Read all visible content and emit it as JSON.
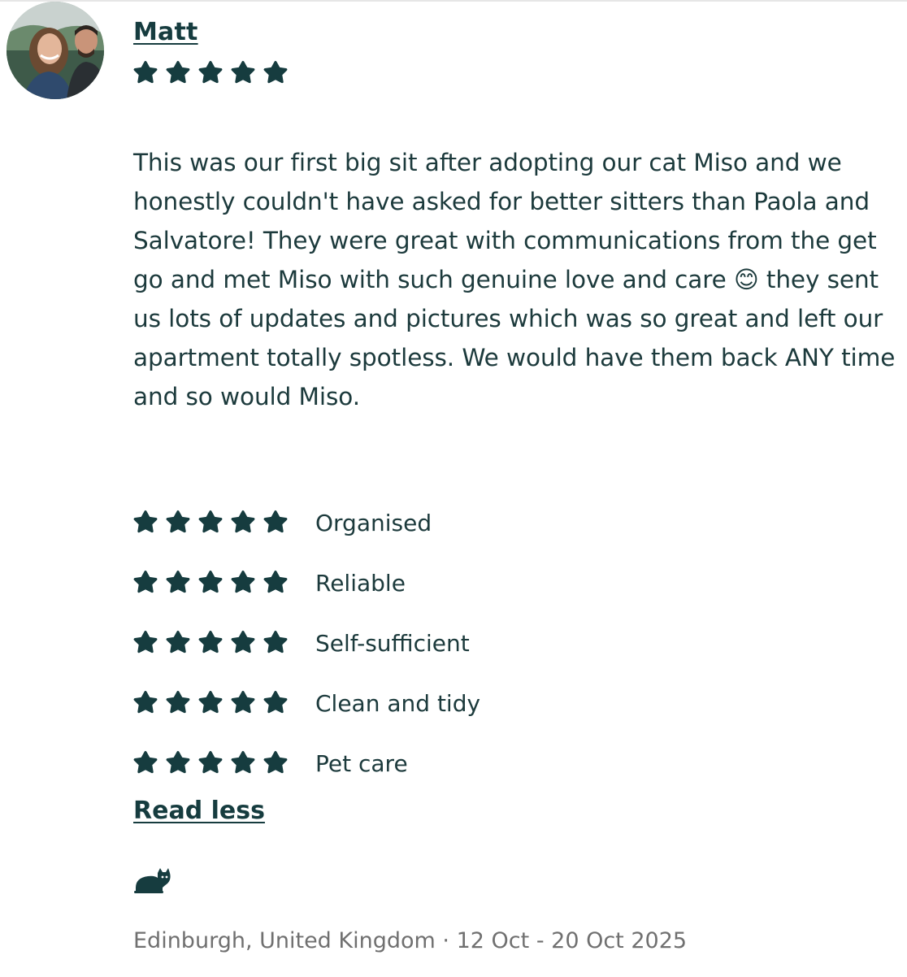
{
  "reviewer": {
    "name": "Matt",
    "overall_rating": 5
  },
  "review": {
    "text_before_emoji": "This was our first big sit after adopting our cat Miso and we honestly couldn't have asked for better sitters than Paola and Salvatore! They were great with communications from the get go and met Miso with such genuine love and care ",
    "emoji": "😊",
    "text_after_emoji": " they sent us lots of updates and pictures which was so great and left our apartment totally spotless. We would have them back ANY time and so would Miso."
  },
  "ratings": [
    {
      "label": "Organised",
      "stars": 5
    },
    {
      "label": "Reliable",
      "stars": 5
    },
    {
      "label": "Self-sufficient",
      "stars": 5
    },
    {
      "label": "Clean and tidy",
      "stars": 5
    },
    {
      "label": "Pet care",
      "stars": 5
    }
  ],
  "read_less_label": "Read less",
  "pet_icon": "cat-icon",
  "footer": {
    "location": "Edinburgh, United Kingdom",
    "separator": "·",
    "dates": "12 Oct - 20 Oct 2025"
  },
  "colors": {
    "star": "#163c3f",
    "text": "#1c3a3c",
    "muted": "#707070"
  }
}
